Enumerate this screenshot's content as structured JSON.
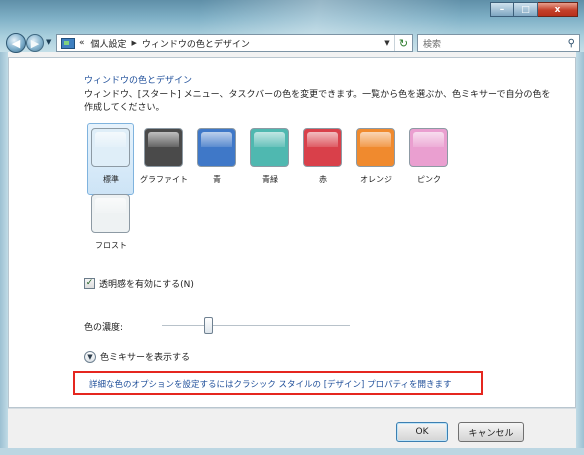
{
  "window": {
    "caption_buttons": [
      "–",
      "□",
      "x"
    ]
  },
  "navigation": {
    "breadcrumb": [
      "個人設定",
      "ウィンドウの色とデザイン"
    ],
    "breadcrumb_prefix": "«",
    "search_placeholder": "検索"
  },
  "main": {
    "heading": "ウィンドウの色とデザイン",
    "description": "ウィンドウ、[スタート] メニュー、タスクバーの色を変更できます。一覧から色を選ぶか、色ミキサーで自分の色を作成してください。",
    "swatches": [
      {
        "label": "標準",
        "color": "#dfeef8",
        "selected": true
      },
      {
        "label": "グラファイト",
        "color": "#4a4a4a"
      },
      {
        "label": "青",
        "color": "#3f78c8"
      },
      {
        "label": "青緑",
        "color": "#4fb8b0"
      },
      {
        "label": "赤",
        "color": "#d9404a"
      },
      {
        "label": "オレンジ",
        "color": "#f08a2e"
      },
      {
        "label": "ピンク",
        "color": "#ea9fd0"
      },
      {
        "label": "フロスト",
        "color": "#eef2f3"
      }
    ],
    "transparency": {
      "label": "透明感を有効にする(N)",
      "checked": true
    },
    "intensity": {
      "label": "色の濃度:",
      "value_fraction": 0.25
    },
    "mixer_toggle": "色ミキサーを表示する",
    "classic_link": "詳細な色のオプションを設定するにはクラシック スタイルの [デザイン] プロパティを開きます"
  },
  "footer": {
    "ok_label": "OK",
    "cancel_label": "キャンセル"
  }
}
